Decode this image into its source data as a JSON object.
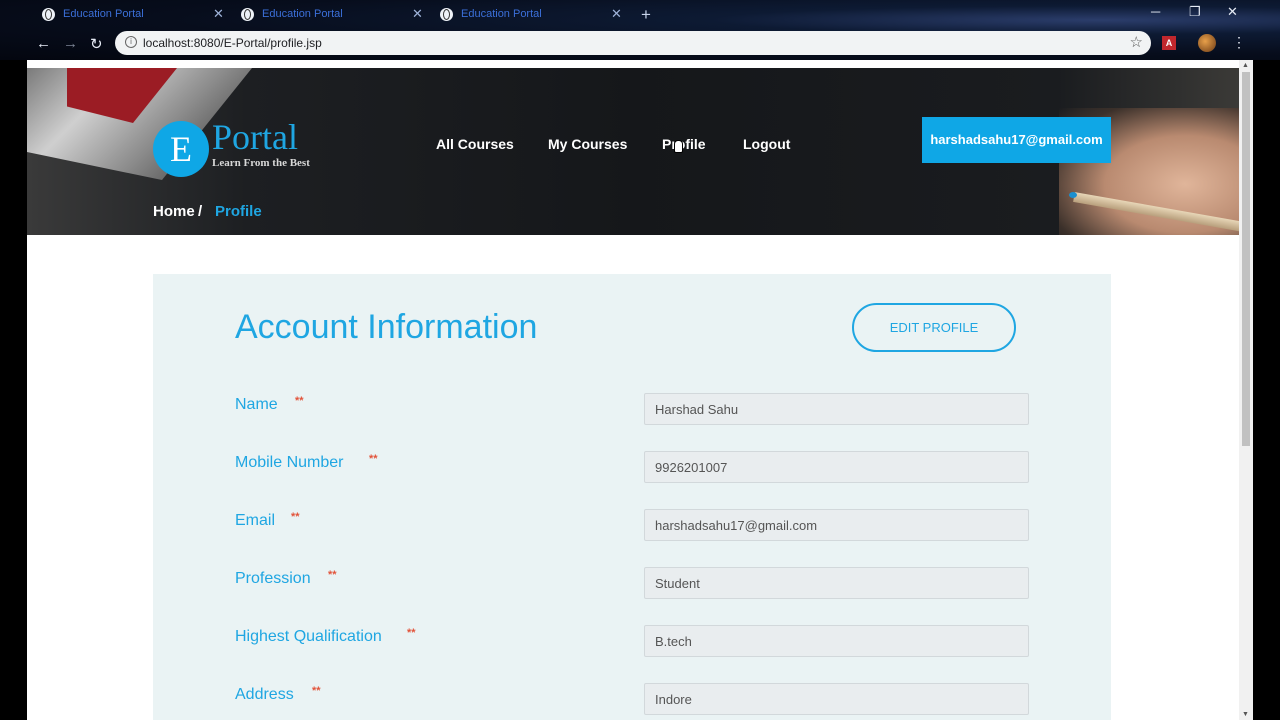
{
  "browser": {
    "tabs": [
      {
        "title": "Education Portal"
      },
      {
        "title": "Education Portal"
      },
      {
        "title": "Education Portal"
      }
    ],
    "new_tab": "+",
    "url": "localhost:8080/E-Portal/profile.jsp",
    "window_controls": {
      "minimize": "─",
      "maximize": "❐",
      "close": "✕"
    }
  },
  "header": {
    "logo_letter": "E",
    "logo_word": "Portal",
    "logo_tagline": "Learn From the Best",
    "nav": [
      "All Courses",
      "My Courses",
      "Profile",
      "Logout"
    ],
    "user_email": "harshadsahu17@gmail.com",
    "breadcrumb": {
      "home": "Home",
      "separator": "/",
      "current": "Profile"
    }
  },
  "account": {
    "title": "Account Information",
    "edit_label": "EDIT PROFILE",
    "required_mark": "**",
    "fields": [
      {
        "label": "Name",
        "value": "Harshad Sahu"
      },
      {
        "label": "Mobile Number",
        "value": "9926201007"
      },
      {
        "label": "Email",
        "value": "harshadsahu17@gmail.com"
      },
      {
        "label": "Profession",
        "value": "Student"
      },
      {
        "label": "Highest Qualification",
        "value": "B.tech"
      },
      {
        "label": "Address",
        "value": "Indore"
      }
    ]
  },
  "colors": {
    "accent": "#1fa6e2",
    "required": "#e2533a",
    "panel_bg": "#eaf3f4"
  }
}
